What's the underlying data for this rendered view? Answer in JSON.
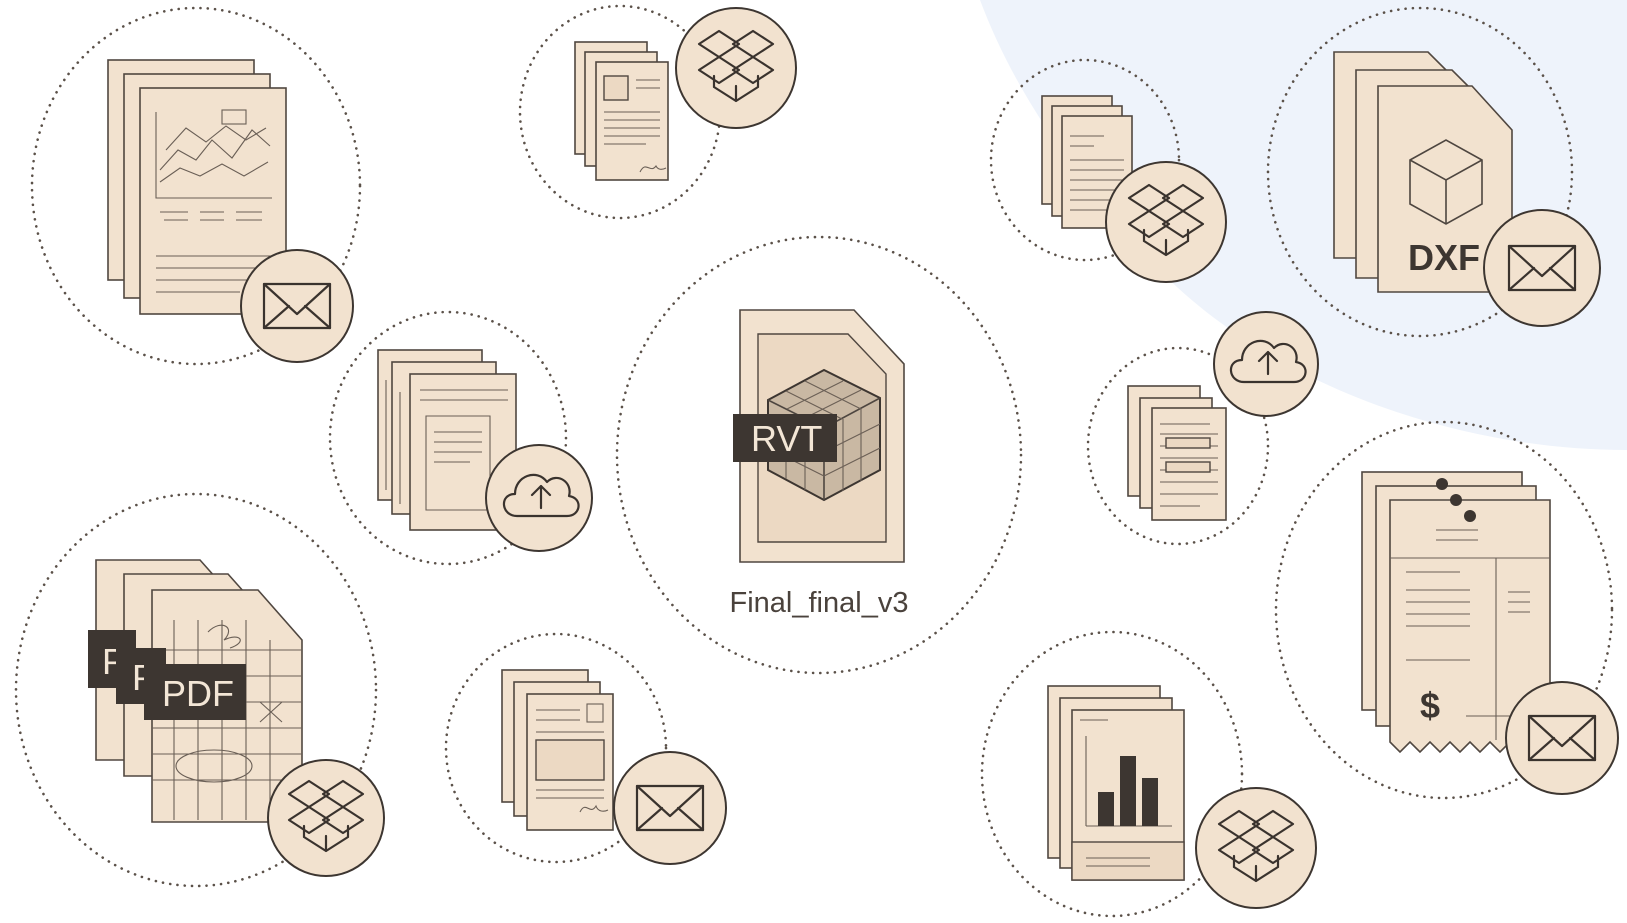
{
  "center_file": {
    "tag": "RVT",
    "filename": "Final_final_v3"
  },
  "tags": {
    "pdf": "PDF",
    "pdf_partial": "P",
    "dxf": "DXF",
    "currency": "$"
  },
  "icons": [
    "envelope-icon",
    "dropbox-icon",
    "cloud-upload-icon",
    "cube-icon",
    "bar-chart-icon"
  ],
  "colors": {
    "paper": "#f2e2cf",
    "ink": "#3d3631",
    "ring": "#5b5149",
    "background_tint": "#eef3fb"
  }
}
